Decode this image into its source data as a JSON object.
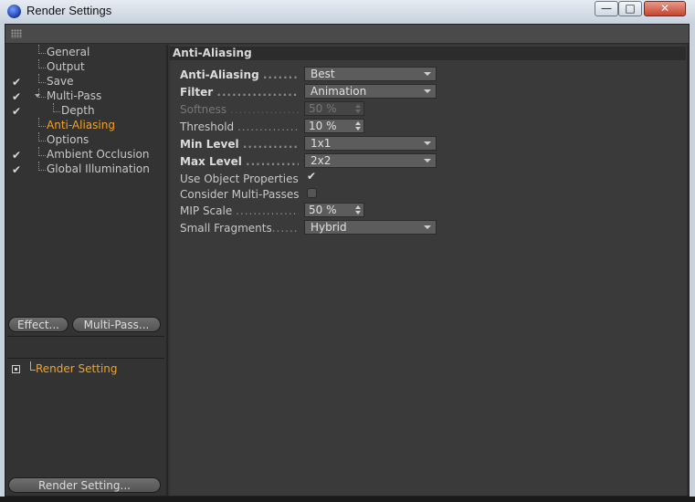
{
  "window": {
    "title": "Render Settings",
    "min_glyph": "—",
    "max_glyph": "□",
    "close_glyph": "✕"
  },
  "tree": [
    {
      "label": "General",
      "checked": false,
      "active": false,
      "indent": 1
    },
    {
      "label": "Output",
      "checked": false,
      "active": false,
      "indent": 1
    },
    {
      "label": "Save",
      "checked": true,
      "active": false,
      "indent": 1
    },
    {
      "label": "Multi-Pass",
      "checked": true,
      "active": false,
      "indent": 1,
      "expanded": true
    },
    {
      "label": "Depth",
      "checked": true,
      "active": false,
      "indent": 2
    },
    {
      "label": "Anti-Aliasing",
      "checked": false,
      "active": true,
      "indent": 1
    },
    {
      "label": "Options",
      "checked": false,
      "active": false,
      "indent": 1
    },
    {
      "label": "Ambient Occlusion",
      "checked": true,
      "active": false,
      "indent": 1
    },
    {
      "label": "Global Illumination",
      "checked": true,
      "active": false,
      "indent": 1
    }
  ],
  "buttons": {
    "effect": "Effect...",
    "multipass": "Multi-Pass...",
    "render_setting": "Render Setting..."
  },
  "render_setting_item": "Render Setting",
  "check_glyph": "✔",
  "section": {
    "title": "Anti-Aliasing"
  },
  "props": {
    "anti_aliasing": {
      "label": "Anti-Aliasing",
      "value": "Best"
    },
    "filter": {
      "label": "Filter",
      "value": "Animation"
    },
    "softness": {
      "label": "Softness",
      "value": "50 %"
    },
    "threshold": {
      "label": "Threshold",
      "value": "10 %"
    },
    "min_level": {
      "label": "Min Level",
      "value": "1x1"
    },
    "max_level": {
      "label": "Max Level",
      "value": "2x2"
    },
    "use_object_properties": {
      "label": "Use Object Properties",
      "checked": true
    },
    "consider_multi_passes": {
      "label": "Consider Multi-Passes",
      "checked": false
    },
    "mip_scale": {
      "label": "MIP Scale",
      "value": "50 %"
    },
    "small_fragments": {
      "label": "Small Fragments",
      "value": "Hybrid"
    }
  },
  "colors": {
    "accent": "#f0a32a",
    "panel": "#3a3a3a",
    "sidebar": "#333333"
  }
}
